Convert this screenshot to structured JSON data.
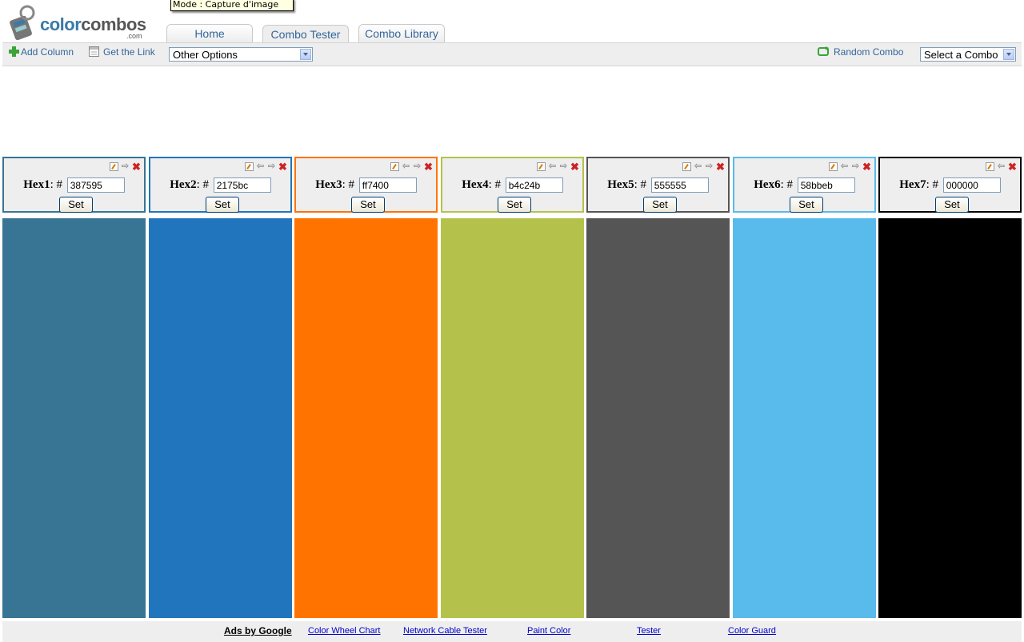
{
  "tooltip": "Mode : Capture d'image",
  "logo": {
    "main": "color",
    "accent": "combos",
    "suffix": ".com"
  },
  "tabs": [
    {
      "label": "Home"
    },
    {
      "label": "Combo Tester"
    },
    {
      "label": "Combo Library"
    }
  ],
  "toolbar": {
    "add_column": "Add Column",
    "get_link": "Get the Link",
    "other_options": "Other Options",
    "random_combo": "Random Combo",
    "select_combo": "Select a Combo"
  },
  "columns": [
    {
      "label": "Hex1",
      "value": "387595",
      "color": "#387595",
      "set": "Set"
    },
    {
      "label": "Hex2",
      "value": "2175bc",
      "color": "#2175bc",
      "set": "Set"
    },
    {
      "label": "Hex3",
      "value": "ff7400",
      "color": "#ff7400",
      "set": "Set"
    },
    {
      "label": "Hex4",
      "value": "b4c24b",
      "color": "#b4c24b",
      "set": "Set"
    },
    {
      "label": "Hex5",
      "value": "555555",
      "color": "#555555",
      "set": "Set"
    },
    {
      "label": "Hex6",
      "value": "58bbeb",
      "color": "#58bbeb",
      "set": "Set"
    },
    {
      "label": "Hex7",
      "value": "000000",
      "color": "#000000",
      "set": "Set"
    }
  ],
  "footer": {
    "ads": "Ads by Google",
    "links": [
      "Color Wheel Chart",
      "Network Cable Tester",
      "Paint Color",
      "Tester",
      "Color Guard"
    ]
  }
}
